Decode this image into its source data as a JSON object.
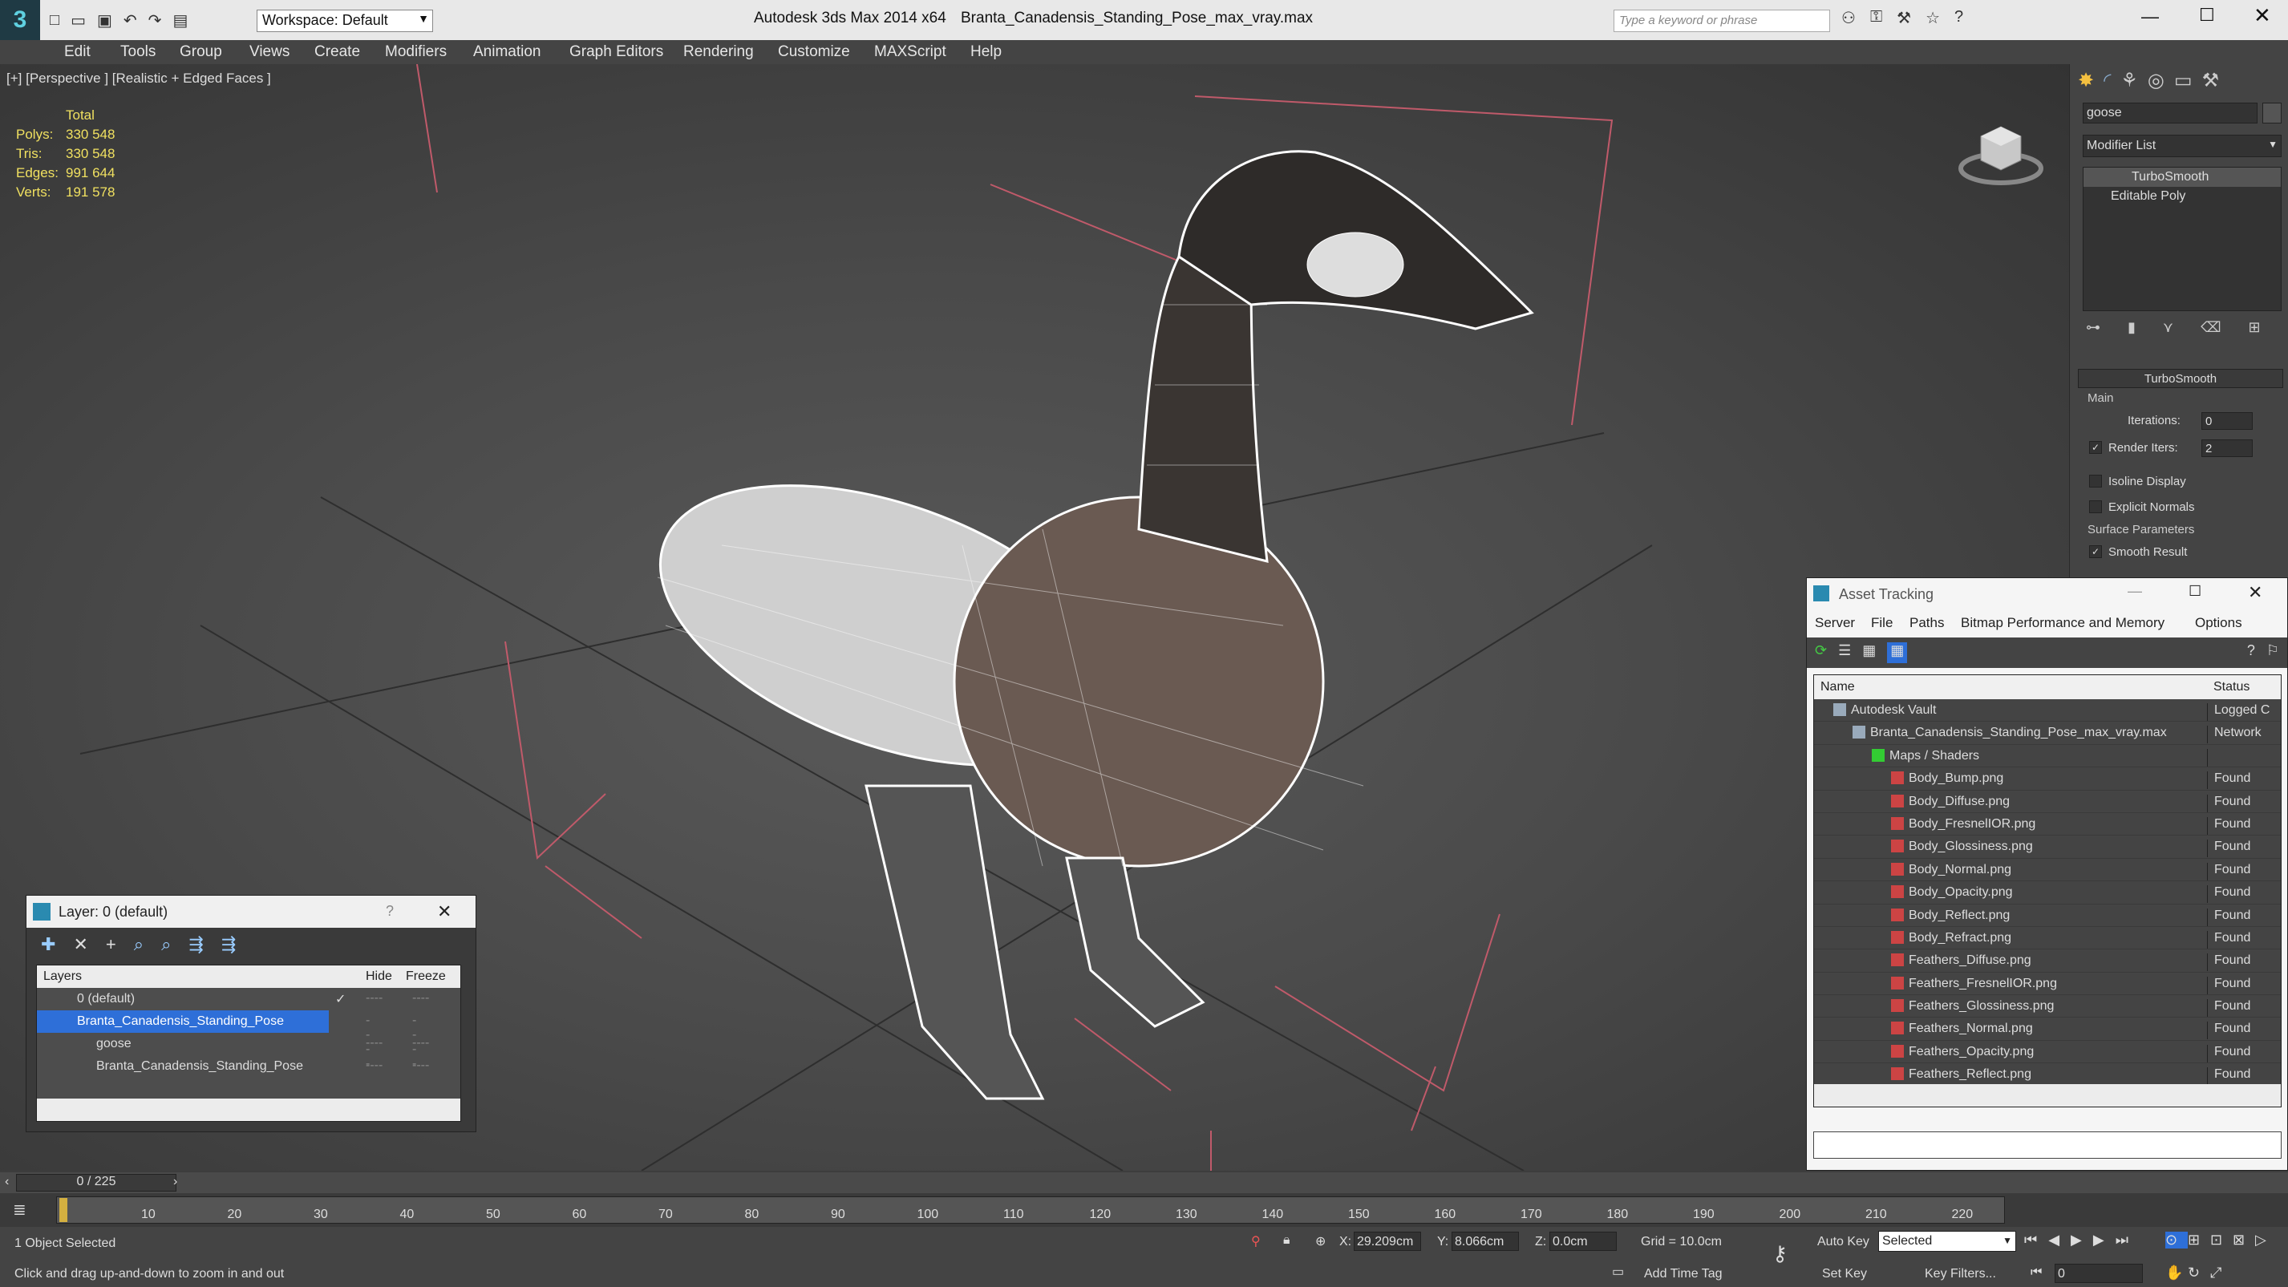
{
  "titlebar": {
    "app": "Autodesk 3ds Max  2014 x64",
    "file": "Branta_Canadensis_Standing_Pose_max_vray.max",
    "workspace": "Workspace: Default",
    "search_placeholder": "Type a keyword or phrase"
  },
  "menu": [
    "Edit",
    "Tools",
    "Group",
    "Views",
    "Create",
    "Modifiers",
    "Animation",
    "Graph Editors",
    "Rendering",
    "Customize",
    "MAXScript",
    "Help"
  ],
  "viewport": {
    "label": "[+] [Perspective ] [Realistic + Edged Faces ]",
    "stats": {
      "header": "Total",
      "rows": [
        {
          "k": "Polys:",
          "v": "330 548"
        },
        {
          "k": "Tris:",
          "v": "330 548"
        },
        {
          "k": "Edges:",
          "v": "991 644"
        },
        {
          "k": "Verts:",
          "v": "191 578"
        }
      ]
    }
  },
  "command_panel": {
    "object_name": "goose",
    "modifier_list": "Modifier List",
    "stack": [
      "TurboSmooth",
      "Editable Poly"
    ],
    "rollout": "TurboSmooth",
    "main": "Main",
    "iterations_label": "Iterations:",
    "iterations": "0",
    "render_iters_label": "Render Iters:",
    "render_iters": "2",
    "isoline": "Isoline Display",
    "explicit": "Explicit Normals",
    "surface": "Surface Parameters",
    "smooth": "Smooth Result"
  },
  "layer": {
    "title": "Layer: 0 (default)",
    "col_layers": "Layers",
    "col_hide": "Hide",
    "col_freeze": "Freeze",
    "rows": [
      {
        "name": "0 (default)",
        "check": "✓"
      },
      {
        "name": "Branta_Canadensis_Standing_Pose",
        "check": ""
      },
      {
        "name": "goose",
        "check": ""
      },
      {
        "name": "Branta_Canadensis_Standing_Pose",
        "check": ""
      }
    ],
    "dash": "----"
  },
  "assets": {
    "title": "Asset Tracking",
    "menu": [
      "Server",
      "File",
      "Paths",
      "Bitmap Performance and Memory",
      "Options"
    ],
    "col_name": "Name",
    "col_status": "Status",
    "rows": [
      {
        "name": "Autodesk Vault",
        "status": "Logged C",
        "indent": 1
      },
      {
        "name": "Branta_Canadensis_Standing_Pose_max_vray.max",
        "status": "Network",
        "indent": 2
      },
      {
        "name": "Maps / Shaders",
        "status": "",
        "indent": 3
      },
      {
        "name": "Body_Bump.png",
        "status": "Found",
        "indent": 4
      },
      {
        "name": "Body_Diffuse.png",
        "status": "Found",
        "indent": 4
      },
      {
        "name": "Body_FresnelIOR.png",
        "status": "Found",
        "indent": 4
      },
      {
        "name": "Body_Glossiness.png",
        "status": "Found",
        "indent": 4
      },
      {
        "name": "Body_Normal.png",
        "status": "Found",
        "indent": 4
      },
      {
        "name": "Body_Opacity.png",
        "status": "Found",
        "indent": 4
      },
      {
        "name": "Body_Reflect.png",
        "status": "Found",
        "indent": 4
      },
      {
        "name": "Body_Refract.png",
        "status": "Found",
        "indent": 4
      },
      {
        "name": "Feathers_Diffuse.png",
        "status": "Found",
        "indent": 4
      },
      {
        "name": "Feathers_FresnelIOR.png",
        "status": "Found",
        "indent": 4
      },
      {
        "name": "Feathers_Glossiness.png",
        "status": "Found",
        "indent": 4
      },
      {
        "name": "Feathers_Normal.png",
        "status": "Found",
        "indent": 4
      },
      {
        "name": "Feathers_Opacity.png",
        "status": "Found",
        "indent": 4
      },
      {
        "name": "Feathers_Reflect.png",
        "status": "Found",
        "indent": 4
      }
    ]
  },
  "timeline": {
    "frame": "0 / 225",
    "ticks": [
      "10",
      "20",
      "30",
      "40",
      "50",
      "60",
      "70",
      "80",
      "90",
      "100",
      "110",
      "120",
      "130",
      "140",
      "150",
      "160",
      "170",
      "180",
      "190",
      "200",
      "210",
      "220"
    ]
  },
  "status": {
    "selected": "1 Object Selected",
    "prompt": "Click and drag up-and-down to zoom in and out",
    "x_label": "X:",
    "x": "29.209cm",
    "y_label": "Y:",
    "y": "8.066cm",
    "z_label": "Z:",
    "z": "0.0cm",
    "grid": "Grid = 10.0cm",
    "add_time_tag": "Add Time Tag",
    "auto_key": "Auto Key",
    "selected_dropdown": "Selected",
    "set_key": "Set Key",
    "key_filters": "Key Filters...",
    "frame_field": "0"
  }
}
